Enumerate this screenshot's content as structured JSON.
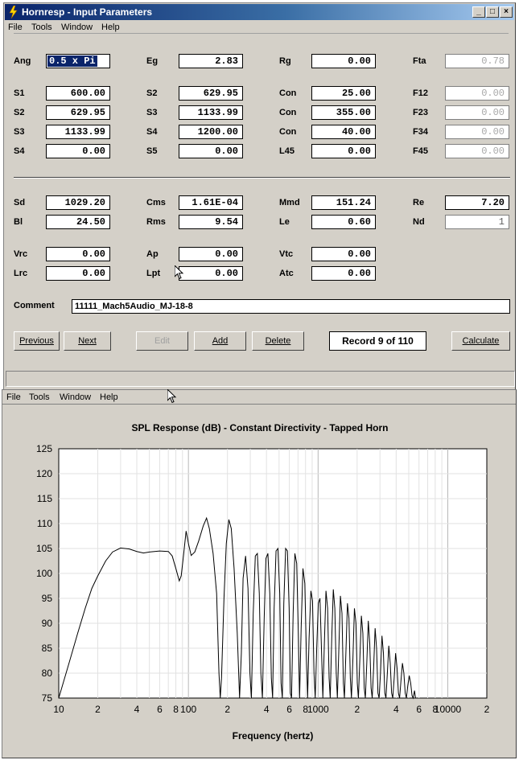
{
  "window": {
    "title": "Hornresp - Input Parameters",
    "menus": [
      "File",
      "Tools",
      "Window",
      "Help"
    ],
    "controls": [
      "_",
      "□",
      "×"
    ]
  },
  "params": {
    "Ang": "0.5 x Pi",
    "Eg": "2.83",
    "Rg": "0.00",
    "Fta": "0.78",
    "S1": "600.00",
    "S2a": "629.95",
    "Con1": "25.00",
    "F12": "0.00",
    "S2b": "629.95",
    "S3a": "1133.99",
    "Con2": "355.00",
    "F23": "0.00",
    "S3b": "1133.99",
    "S4a": "1200.00",
    "Con3": "40.00",
    "F34": "0.00",
    "S4b": "0.00",
    "S5": "0.00",
    "L45": "0.00",
    "F45": "0.00",
    "Sd": "1029.20",
    "Cms": "1.61E-04",
    "Mmd": "151.24",
    "Re": "7.20",
    "Bl": "24.50",
    "Rms": "9.54",
    "Le": "0.60",
    "Nd": "1",
    "Vrc": "0.00",
    "Ap": "0.00",
    "Vtc": "0.00",
    "Lrc": "0.00",
    "Lpt": "0.00",
    "Atc": "0.00"
  },
  "labels": {
    "Ang": "Ang",
    "Eg": "Eg",
    "Rg": "Rg",
    "Fta": "Fta",
    "S1": "S1",
    "S2": "S2",
    "S3": "S3",
    "S4": "S4",
    "S5": "S5",
    "Con": "Con",
    "F12": "F12",
    "F23": "F23",
    "F34": "F34",
    "F45": "F45",
    "L45": "L45",
    "Sd": "Sd",
    "Cms": "Cms",
    "Mmd": "Mmd",
    "Re": "Re",
    "Bl": "Bl",
    "Rms": "Rms",
    "Le": "Le",
    "Nd": "Nd",
    "Vrc": "Vrc",
    "Ap": "Ap",
    "Vtc": "Vtc",
    "Lrc": "Lrc",
    "Lpt": "Lpt",
    "Atc": "Atc",
    "Comment": "Comment"
  },
  "comment": "11111_Mach5Audio_MJ-18-8",
  "buttons": {
    "previous": "Previous",
    "next": "Next",
    "edit": "Edit",
    "add": "Add",
    "delete": "Delete",
    "calculate": "Calculate"
  },
  "record": "Record 9 of 110",
  "chart_window": {
    "menus": [
      "File",
      "Tools",
      "Window",
      "Help"
    ]
  },
  "chart_data": {
    "type": "line",
    "title": "SPL Response (dB) - Constant Directivity - Tapped Horn",
    "xlabel": "Frequency (hertz)",
    "ylabel": "",
    "xscale": "log",
    "xlim": [
      10,
      20000
    ],
    "ylim": [
      75,
      125
    ],
    "yticks": [
      75,
      80,
      85,
      90,
      95,
      100,
      105,
      110,
      115,
      120,
      125
    ],
    "xtick_labels": [
      {
        "x": 10,
        "label": "10"
      },
      {
        "x": 20,
        "label": "2"
      },
      {
        "x": 40,
        "label": "4"
      },
      {
        "x": 60,
        "label": "6"
      },
      {
        "x": 80,
        "label": "8"
      },
      {
        "x": 100,
        "label": "100"
      },
      {
        "x": 200,
        "label": "2"
      },
      {
        "x": 400,
        "label": "4"
      },
      {
        "x": 600,
        "label": "6"
      },
      {
        "x": 800,
        "label": "8"
      },
      {
        "x": 1000,
        "label": "1000"
      },
      {
        "x": 2000,
        "label": "2"
      },
      {
        "x": 4000,
        "label": "4"
      },
      {
        "x": 6000,
        "label": "6"
      },
      {
        "x": 8000,
        "label": "8"
      },
      {
        "x": 10000,
        "label": "10000"
      },
      {
        "x": 20000,
        "label": "2"
      }
    ],
    "grid": true,
    "series": [
      {
        "color": "#000000",
        "points": [
          [
            10,
            75
          ],
          [
            12,
            82
          ],
          [
            14,
            88
          ],
          [
            16,
            93
          ],
          [
            18,
            97
          ],
          [
            20,
            99.5
          ],
          [
            23,
            102.5
          ],
          [
            26,
            104.3
          ],
          [
            30,
            105.1
          ],
          [
            35,
            104.9
          ],
          [
            40,
            104.4
          ],
          [
            45,
            104.1
          ],
          [
            50,
            104.3
          ],
          [
            60,
            104.5
          ],
          [
            70,
            104.4
          ],
          [
            75,
            103.5
          ],
          [
            80,
            101
          ],
          [
            85,
            98.5
          ],
          [
            88,
            99.5
          ],
          [
            92,
            104
          ],
          [
            96,
            108.5
          ],
          [
            100,
            106
          ],
          [
            105,
            103.6
          ],
          [
            112,
            104.3
          ],
          [
            120,
            106.5
          ],
          [
            130,
            109.5
          ],
          [
            138,
            111.1
          ],
          [
            145,
            109
          ],
          [
            155,
            104
          ],
          [
            165,
            96
          ],
          [
            172,
            80
          ],
          [
            176,
            75
          ],
          [
            180,
            79
          ],
          [
            188,
            95
          ],
          [
            196,
            106
          ],
          [
            205,
            110.8
          ],
          [
            214,
            109
          ],
          [
            225,
            101
          ],
          [
            238,
            88
          ],
          [
            248,
            75
          ],
          [
            256,
            84
          ],
          [
            264,
            99
          ],
          [
            276,
            103.5
          ],
          [
            288,
            97
          ],
          [
            298,
            80
          ],
          [
            306,
            75
          ],
          [
            316,
            92
          ],
          [
            328,
            103.5
          ],
          [
            340,
            104
          ],
          [
            352,
            96
          ],
          [
            362,
            80
          ],
          [
            372,
            75
          ],
          [
            384,
            91
          ],
          [
            396,
            103
          ],
          [
            410,
            104
          ],
          [
            424,
            96
          ],
          [
            436,
            79
          ],
          [
            446,
            75
          ],
          [
            458,
            93
          ],
          [
            474,
            104.5
          ],
          [
            490,
            105
          ],
          [
            506,
            96
          ],
          [
            518,
            78
          ],
          [
            530,
            75
          ],
          [
            544,
            94
          ],
          [
            562,
            105
          ],
          [
            580,
            104.5
          ],
          [
            598,
            93
          ],
          [
            612,
            76
          ],
          [
            624,
            75
          ],
          [
            642,
            92
          ],
          [
            662,
            104
          ],
          [
            684,
            102
          ],
          [
            704,
            88
          ],
          [
            720,
            75
          ],
          [
            740,
            89
          ],
          [
            764,
            101
          ],
          [
            790,
            98
          ],
          [
            812,
            84
          ],
          [
            830,
            75
          ],
          [
            852,
            87
          ],
          [
            880,
            96.5
          ],
          [
            906,
            94.5
          ],
          [
            930,
            80
          ],
          [
            950,
            75
          ],
          [
            976,
            85
          ],
          [
            1004,
            94
          ],
          [
            1034,
            95
          ],
          [
            1064,
            84
          ],
          [
            1088,
            75
          ],
          [
            1118,
            86
          ],
          [
            1150,
            96.5
          ],
          [
            1184,
            93
          ],
          [
            1216,
            79
          ],
          [
            1240,
            75
          ],
          [
            1274,
            87
          ],
          [
            1310,
            96.8
          ],
          [
            1346,
            93
          ],
          [
            1380,
            80
          ],
          [
            1408,
            75
          ],
          [
            1446,
            85
          ],
          [
            1486,
            95.5
          ],
          [
            1528,
            92
          ],
          [
            1566,
            78
          ],
          [
            1596,
            75
          ],
          [
            1638,
            84
          ],
          [
            1684,
            94
          ],
          [
            1730,
            91
          ],
          [
            1772,
            79
          ],
          [
            1808,
            75
          ],
          [
            1856,
            83
          ],
          [
            1906,
            93
          ],
          [
            1958,
            90
          ],
          [
            2006,
            78
          ],
          [
            2046,
            75
          ],
          [
            2100,
            83
          ],
          [
            2156,
            91.5
          ],
          [
            2214,
            88
          ],
          [
            2268,
            77
          ],
          [
            2314,
            75
          ],
          [
            2374,
            82
          ],
          [
            2438,
            90.5
          ],
          [
            2502,
            86
          ],
          [
            2562,
            77
          ],
          [
            2614,
            75
          ],
          [
            2680,
            81
          ],
          [
            2752,
            89
          ],
          [
            2824,
            85
          ],
          [
            2894,
            76
          ],
          [
            2954,
            75
          ],
          [
            3028,
            80
          ],
          [
            3108,
            87.5
          ],
          [
            3190,
            84
          ],
          [
            3268,
            76
          ],
          [
            3336,
            75
          ],
          [
            3420,
            80
          ],
          [
            3508,
            85.5
          ],
          [
            3600,
            82
          ],
          [
            3688,
            76
          ],
          [
            3766,
            75
          ],
          [
            3860,
            79
          ],
          [
            3960,
            84
          ],
          [
            4064,
            81
          ],
          [
            4162,
            76
          ],
          [
            4250,
            75
          ],
          [
            4356,
            78.5
          ],
          [
            4470,
            82
          ],
          [
            4586,
            80
          ],
          [
            4696,
            76
          ],
          [
            4796,
            75
          ],
          [
            4916,
            77.5
          ],
          [
            5044,
            79.5
          ],
          [
            5176,
            78
          ],
          [
            5300,
            75.5
          ],
          [
            5410,
            75
          ],
          [
            5540,
            76.5
          ],
          [
            5640,
            75
          ]
        ]
      }
    ]
  }
}
